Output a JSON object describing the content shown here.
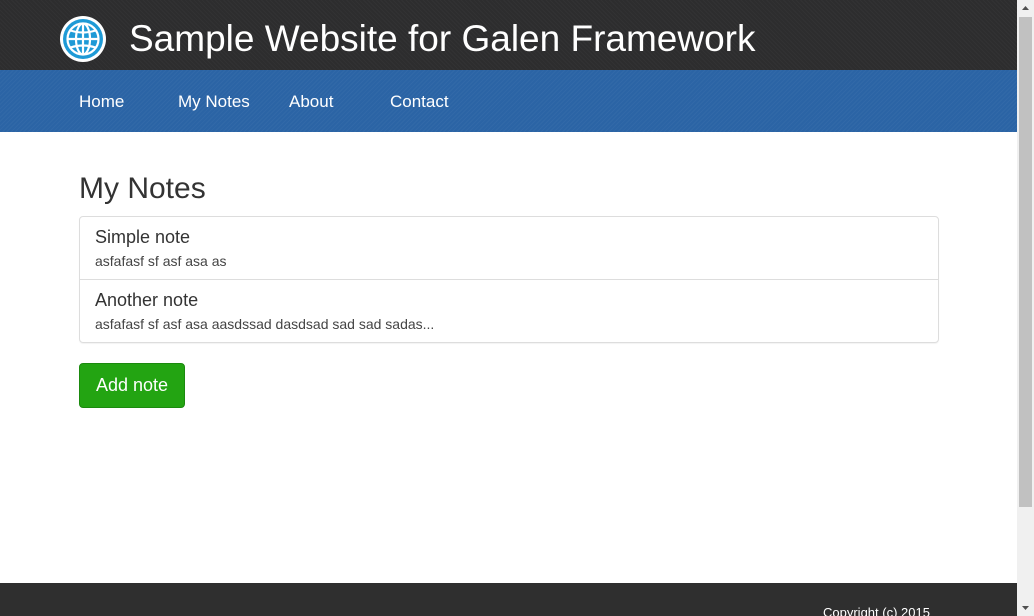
{
  "header": {
    "logo_icon": "globe-icon",
    "site_title": "Sample Website for Galen Framework"
  },
  "nav": {
    "items": [
      {
        "label": "Home"
      },
      {
        "label": "My Notes"
      },
      {
        "label": "About"
      },
      {
        "label": "Contact"
      }
    ]
  },
  "content": {
    "title": "My Notes",
    "notes": [
      {
        "title": "Simple note",
        "description": "asfafasf sf asf asa as"
      },
      {
        "title": "Another note",
        "description": "asfafasf sf asf asa aasdssad dasdsad sad sad sadas..."
      }
    ],
    "add_button_label": "Add note"
  },
  "footer": {
    "copyright": "Copyright (c) 2015"
  },
  "colors": {
    "header_bg": "#2d2d2e",
    "nav_bg": "#2b64a5",
    "button_green": "#23a412",
    "footer_bg": "#2f2f2f"
  }
}
